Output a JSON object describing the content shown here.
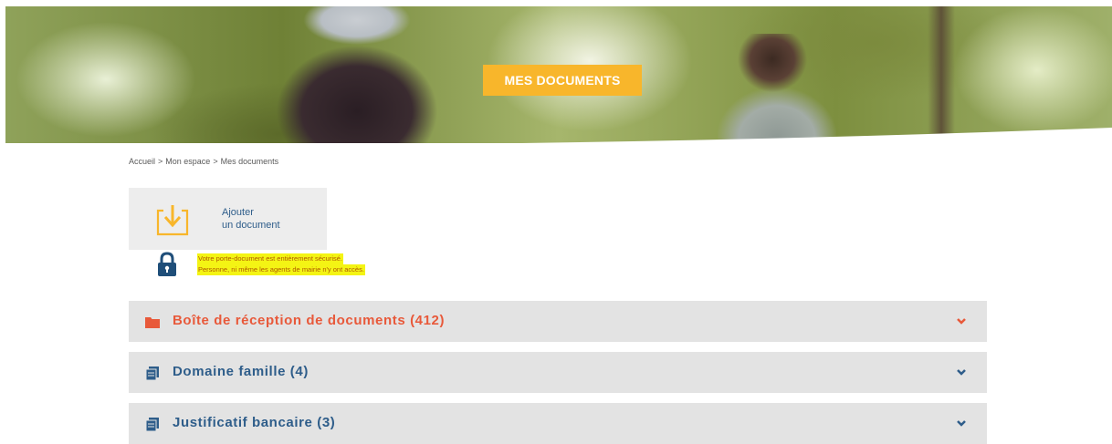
{
  "hero": {
    "title": "MES DOCUMENTS"
  },
  "breadcrumb": [
    "Accueil",
    "Mon espace",
    "Mes documents"
  ],
  "breadcrumb_separator": ">",
  "add_document": {
    "line1": "Ajouter",
    "line2": "un document",
    "icon": "download-tray-icon"
  },
  "security": {
    "icon": "lock-icon",
    "line1": "Votre porte-document est entièrement sécurisé.",
    "line2": "Personne, ni même les agents de mairie n'y ont accès."
  },
  "accordions": [
    {
      "label": "Boîte de réception de documents (412)",
      "icon": "folder-icon",
      "color": "#e8593a"
    },
    {
      "label": "Domaine famille (4)",
      "icon": "documents-icon",
      "color": "#2e5d8a"
    },
    {
      "label": "Justificatif bancaire (3)",
      "icon": "documents-icon",
      "color": "#2e5d8a"
    }
  ],
  "colors": {
    "accent": "#f8b62b",
    "highlight": "#f4f414",
    "inbox": "#e8593a",
    "primary": "#2e5d8a"
  }
}
